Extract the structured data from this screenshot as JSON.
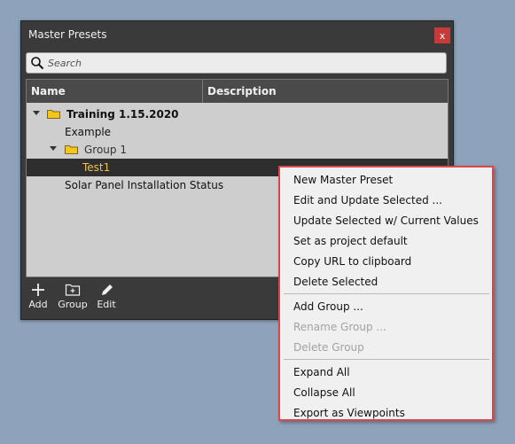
{
  "window": {
    "title": "Master Presets",
    "close_label": "x"
  },
  "search": {
    "placeholder": "Search"
  },
  "columns": {
    "name": "Name",
    "description": "Description"
  },
  "tree": {
    "rows": [
      {
        "label": "Training 1.15.2020",
        "level": 0,
        "bold": true,
        "expanded": true,
        "folder": true
      },
      {
        "label": "Example",
        "level": 1
      },
      {
        "label": "Group 1",
        "level": 1,
        "expanded": true,
        "folder": true
      },
      {
        "label": "Test1",
        "level": 2,
        "selected": true
      },
      {
        "label": "Solar Panel Installation Status",
        "level": 1
      }
    ]
  },
  "toolbar": {
    "add_label": "Add",
    "group_label": "Group",
    "edit_label": "Edit"
  },
  "context_menu": {
    "items": [
      {
        "label": "New Master Preset",
        "enabled": true
      },
      {
        "label": "Edit and Update Selected ...",
        "enabled": true
      },
      {
        "label": "Update Selected w/ Current Values",
        "enabled": true
      },
      {
        "label": "Set as project default",
        "enabled": true
      },
      {
        "label": "Copy URL to clipboard",
        "enabled": true
      },
      {
        "label": "Delete Selected",
        "enabled": true
      },
      {
        "label": "Add Group ...",
        "enabled": true
      },
      {
        "label": "Rename Group ...",
        "enabled": false
      },
      {
        "label": "Delete Group",
        "enabled": false
      },
      {
        "label": "Expand All",
        "enabled": true
      },
      {
        "label": "Collapse All",
        "enabled": true
      },
      {
        "label": "Export as Viewpoints",
        "enabled": true
      }
    ]
  },
  "colors": {
    "desktop": "#8ea3bb",
    "panel": "#3a3a3a",
    "close_button": "#c73a3a",
    "selection_text": "#f2c054",
    "folder": "#f5c518",
    "menu_border": "#d9464d"
  }
}
